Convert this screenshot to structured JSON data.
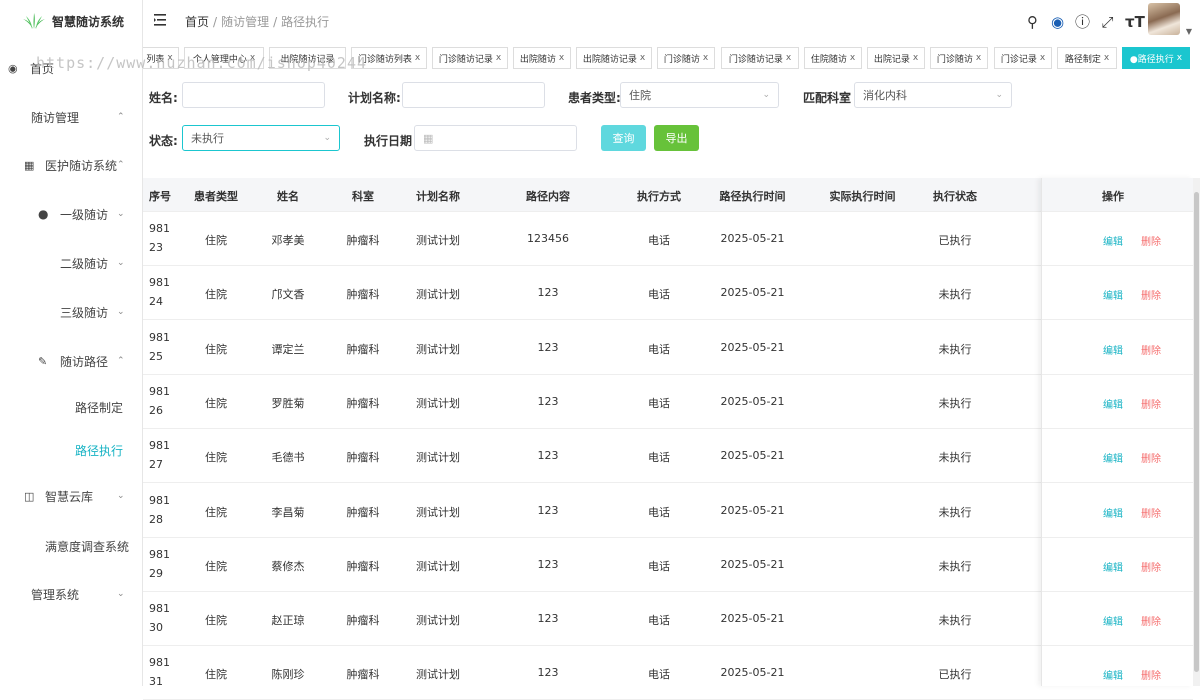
{
  "app": {
    "title": "智慧随访系统"
  },
  "watermark": "https://www.huzhan.com/ishop40244",
  "sidebar": {
    "items": [
      {
        "label": "首页",
        "icon": "dashboard-icon"
      },
      {
        "label": "随访管理"
      },
      {
        "label": "医护随访系统",
        "icon": "grid-icon"
      },
      {
        "label": "一级随访",
        "icon": "user-icon"
      },
      {
        "label": "二级随访"
      },
      {
        "label": "三级随访"
      },
      {
        "label": "随访路径",
        "icon": "edit-icon"
      },
      {
        "label": "路径制定"
      },
      {
        "label": "路径执行"
      },
      {
        "label": "智慧云库",
        "icon": "book-icon"
      },
      {
        "label": "满意度调查系统"
      },
      {
        "label": "管理系统"
      }
    ]
  },
  "header": {
    "breadcrumb": [
      "首页",
      "随访管理",
      "路径执行"
    ],
    "icons": [
      "search-icon",
      "github-icon",
      "help-icon",
      "fullscreen-icon",
      "font-size-icon"
    ]
  },
  "tabs": [
    "列表",
    "个人管理中心",
    "出院随访记录",
    "门诊随访列表",
    "门诊随访记录",
    "出院随访",
    "出院随访记录",
    "门诊随访",
    "门诊随访记录",
    "住院随访",
    "出院记录",
    "门诊随访",
    "门诊记录",
    "路径制定",
    "●路径执行"
  ],
  "filters": {
    "name_label": "姓名:",
    "plan_label": "计划名称:",
    "patient_type_label": "患者类型:",
    "patient_type_value": "住院",
    "dept_label": "匹配科室",
    "dept_value": "消化内科",
    "status_label": "状态:",
    "status_value": "未执行",
    "date_label": "执行日期",
    "query_button": "查询",
    "export_button": "导出",
    "query_color": "#5fd8de",
    "export_color": "#67c23a"
  },
  "table": {
    "headers": [
      "序号",
      "患者类型",
      "姓名",
      "科室",
      "计划名称",
      "路径内容",
      "执行方式",
      "路径执行时间",
      "实际执行时间",
      "执行状态",
      "操作"
    ],
    "edit_label": "编辑",
    "delete_label": "删除",
    "edit_color": "#17b3c4",
    "delete_color": "#f56c6c",
    "rows": [
      {
        "seq": "98123",
        "type": "住院",
        "name": "邓孝美",
        "dept": "肿瘤科",
        "plan": "测试计划",
        "content": "123456",
        "method": "电话",
        "time": "2025-05-21",
        "actual": "",
        "status": "已执行"
      },
      {
        "seq": "98124",
        "type": "住院",
        "name": "邝文香",
        "dept": "肿瘤科",
        "plan": "测试计划",
        "content": "123",
        "method": "电话",
        "time": "2025-05-21",
        "actual": "",
        "status": "未执行"
      },
      {
        "seq": "98125",
        "type": "住院",
        "name": "谭定兰",
        "dept": "肿瘤科",
        "plan": "测试计划",
        "content": "123",
        "method": "电话",
        "time": "2025-05-21",
        "actual": "",
        "status": "未执行"
      },
      {
        "seq": "98126",
        "type": "住院",
        "name": "罗胜菊",
        "dept": "肿瘤科",
        "plan": "测试计划",
        "content": "123",
        "method": "电话",
        "time": "2025-05-21",
        "actual": "",
        "status": "未执行"
      },
      {
        "seq": "98127",
        "type": "住院",
        "name": "毛德书",
        "dept": "肿瘤科",
        "plan": "测试计划",
        "content": "123",
        "method": "电话",
        "time": "2025-05-21",
        "actual": "",
        "status": "未执行"
      },
      {
        "seq": "98128",
        "type": "住院",
        "name": "李昌菊",
        "dept": "肿瘤科",
        "plan": "测试计划",
        "content": "123",
        "method": "电话",
        "time": "2025-05-21",
        "actual": "",
        "status": "未执行"
      },
      {
        "seq": "98129",
        "type": "住院",
        "name": "蔡修杰",
        "dept": "肿瘤科",
        "plan": "测试计划",
        "content": "123",
        "method": "电话",
        "time": "2025-05-21",
        "actual": "",
        "status": "未执行"
      },
      {
        "seq": "98130",
        "type": "住院",
        "name": "赵正琼",
        "dept": "肿瘤科",
        "plan": "测试计划",
        "content": "123",
        "method": "电话",
        "time": "2025-05-21",
        "actual": "",
        "status": "未执行"
      },
      {
        "seq": "98131",
        "type": "住院",
        "name": "陈刚珍",
        "dept": "肿瘤科",
        "plan": "测试计划",
        "content": "123",
        "method": "电话",
        "time": "2025-05-21",
        "actual": "",
        "status": "已执行"
      }
    ]
  }
}
